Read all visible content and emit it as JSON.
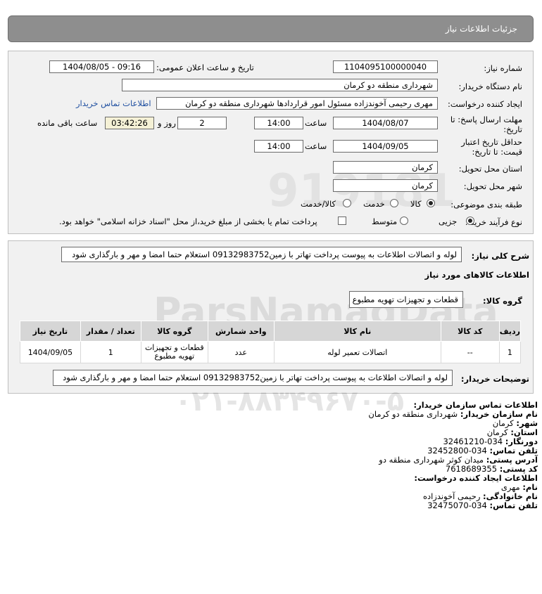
{
  "page": {
    "title": "جزئیات اطلاعات نیاز"
  },
  "form": {
    "need_number_label": "شماره نیاز:",
    "need_number": "1104095100000040",
    "announce_label": "تاریخ و ساعت اعلان عمومی:",
    "announce_value": "1404/08/05 - 09:16",
    "buyer_org_label": "نام دستگاه خریدار:",
    "buyer_org": "شهرداری منطقه دو کرمان",
    "creator_label": "ایجاد کننده درخواست:",
    "creator": "مهری رحیمی آخوندزاده مسئول امور قراردادها شهرداری منطقه دو کرمان",
    "contact_link": "اطلاعات تماس خریدار",
    "deadline_label_1": "مهلت ارسال پاسخ: تا",
    "deadline_label_2": "تاریخ:",
    "deadline_date": "1404/08/07",
    "time_label": "ساعت",
    "deadline_time": "14:00",
    "days_value": "2",
    "days_label": "روز و",
    "remaining_time": "03:42:26",
    "remaining_label": "ساعت باقی مانده",
    "validity_label_1": "حداقل تاریخ اعتبار",
    "validity_label_2": "قیمت: تا تاریخ:",
    "validity_date": "1404/09/05",
    "validity_time": "14:00",
    "province_label": "استان محل تحویل:",
    "province": "کرمان",
    "city_label": "شهر محل تحویل:",
    "city": "کرمان",
    "category_label": "طبقه بندی موضوعی:",
    "category_options": [
      "کالا",
      "خدمت",
      "کالا/خدمت"
    ],
    "process_label": "نوع فرآیند خرید :",
    "process_options": [
      "جزیی",
      "متوسط"
    ],
    "payment_note": "پرداخت تمام یا بخشی از مبلغ خرید،از محل \"اسناد خزانه اسلامی\" خواهد بود."
  },
  "description": {
    "label": "شرح کلی نیاز:",
    "text": "لوله و اتصالات اطلاعات به پیوست پرداخت تهاتر با زمین09132983752 استعلام حتما امضا و مهر و بارگذاری شود"
  },
  "goods": {
    "section_title": "اطلاعات کالاهای مورد نیاز",
    "group_label": "گروه کالا:",
    "group_value": "قطعات و تجهیزات تهویه مطبوع",
    "headers": [
      "ردیف",
      "کد کالا",
      "نام کالا",
      "واحد شمارش",
      "گروه کالا",
      "تعداد / مقدار",
      "تاریخ نیاز"
    ],
    "rows": [
      {
        "index": "1",
        "code": "--",
        "name": "اتصالات تعمیر لوله",
        "unit": "عدد",
        "group_line1": "قطعات و تجهیزات",
        "group_line2": "تهویه مطبوع",
        "quantity": "1",
        "date": "1404/09/05"
      }
    ]
  },
  "buyer_notes": {
    "label": "توضیحات خریدار:",
    "text": "لوله و اتصالات اطلاعات به پیوست پرداخت تهاتر با زمین09132983752 استعلام حتما امضا و مهر و بارگذاری شود"
  },
  "contact": {
    "org_title": "اطلاعات تماس سازمان خریدار:",
    "buyer_name_label": "نام سازمان خریدار:",
    "buyer_name": "شهرداری منطقه دو کرمان",
    "city_label": "شهر:",
    "city": "کرمان",
    "province_label": "استان:",
    "province": "کرمان",
    "fax_label": "دورنگار:",
    "fax": "034-32461210",
    "phone_label": "تلفن تماس:",
    "phone": "034-32452800",
    "address_label": "آدرس پستی:",
    "address": "میدان کوثر شهرداری منطقه دو",
    "postal_label": "کد پستی:",
    "postal": "7618689355",
    "creator_title": "اطلاعات ایجاد کننده درخواست:",
    "first_name_label": "نام:",
    "first_name": "مهری",
    "last_name_label": "نام خانوادگی:",
    "last_name": "رحیمی آخوندزاده",
    "creator_phone_label": "تلفن تماس:",
    "creator_phone": "034-32475070"
  },
  "watermark": {
    "brand": "ParsNamadData",
    "phone": "۰۲۱-۸۸۳۴۹۶۷۰-۵",
    "number": "919181"
  }
}
